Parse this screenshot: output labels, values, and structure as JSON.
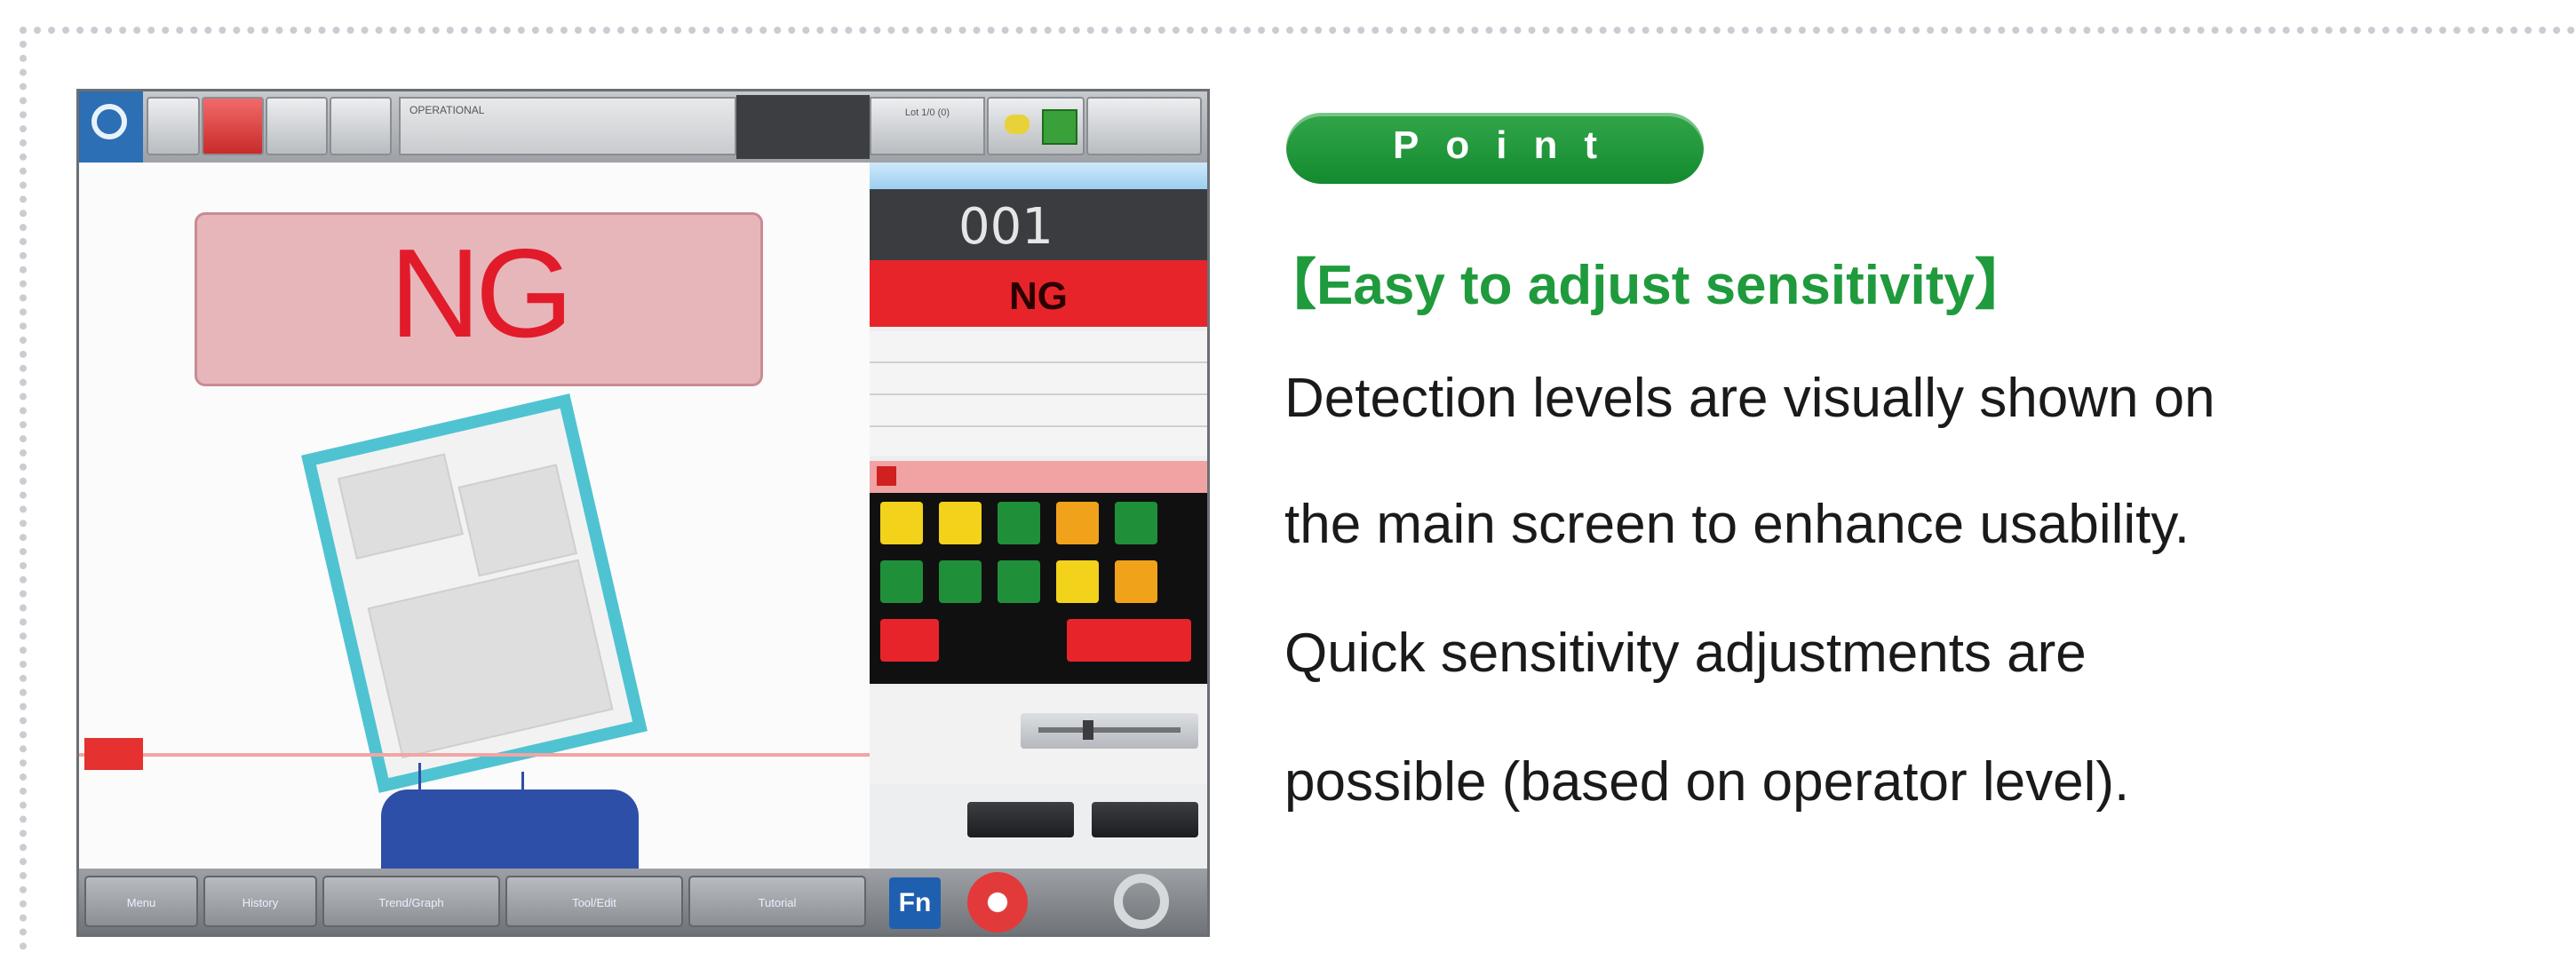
{
  "screenshot": {
    "topbar": {
      "operation_label": "OPERATIONAL",
      "counter_label": "Lot 1/0 (0)"
    },
    "main": {
      "result_text": "NG"
    },
    "side_panel": {
      "channel_number": "001",
      "result_text": "NG"
    },
    "bottom_bar": {
      "buttons": [
        "Menu",
        "History",
        "Trend/Graph",
        "Tool/Edit",
        "Tutorial"
      ],
      "fn_label": "Fn"
    },
    "colors": {
      "ng_red": "#e21b2a",
      "frame_cyan": "#4fc3d1",
      "detect_blue": "#2e4fa8",
      "yellow_cell": "#f2d21b",
      "green_cell": "#1f8f3a",
      "orange_cell": "#f0a21b",
      "red_cell": "#e8242b"
    }
  },
  "point_badge": "Point",
  "heading": "【Easy to adjust sensitivity】",
  "description": {
    "line1": "Detection levels are visually shown on",
    "line2": "the main screen to enhance usability.",
    "line3": "Quick sensitivity adjustments are",
    "line4": "possible (based on operator level)."
  },
  "brand_color": "#1f9a3c"
}
